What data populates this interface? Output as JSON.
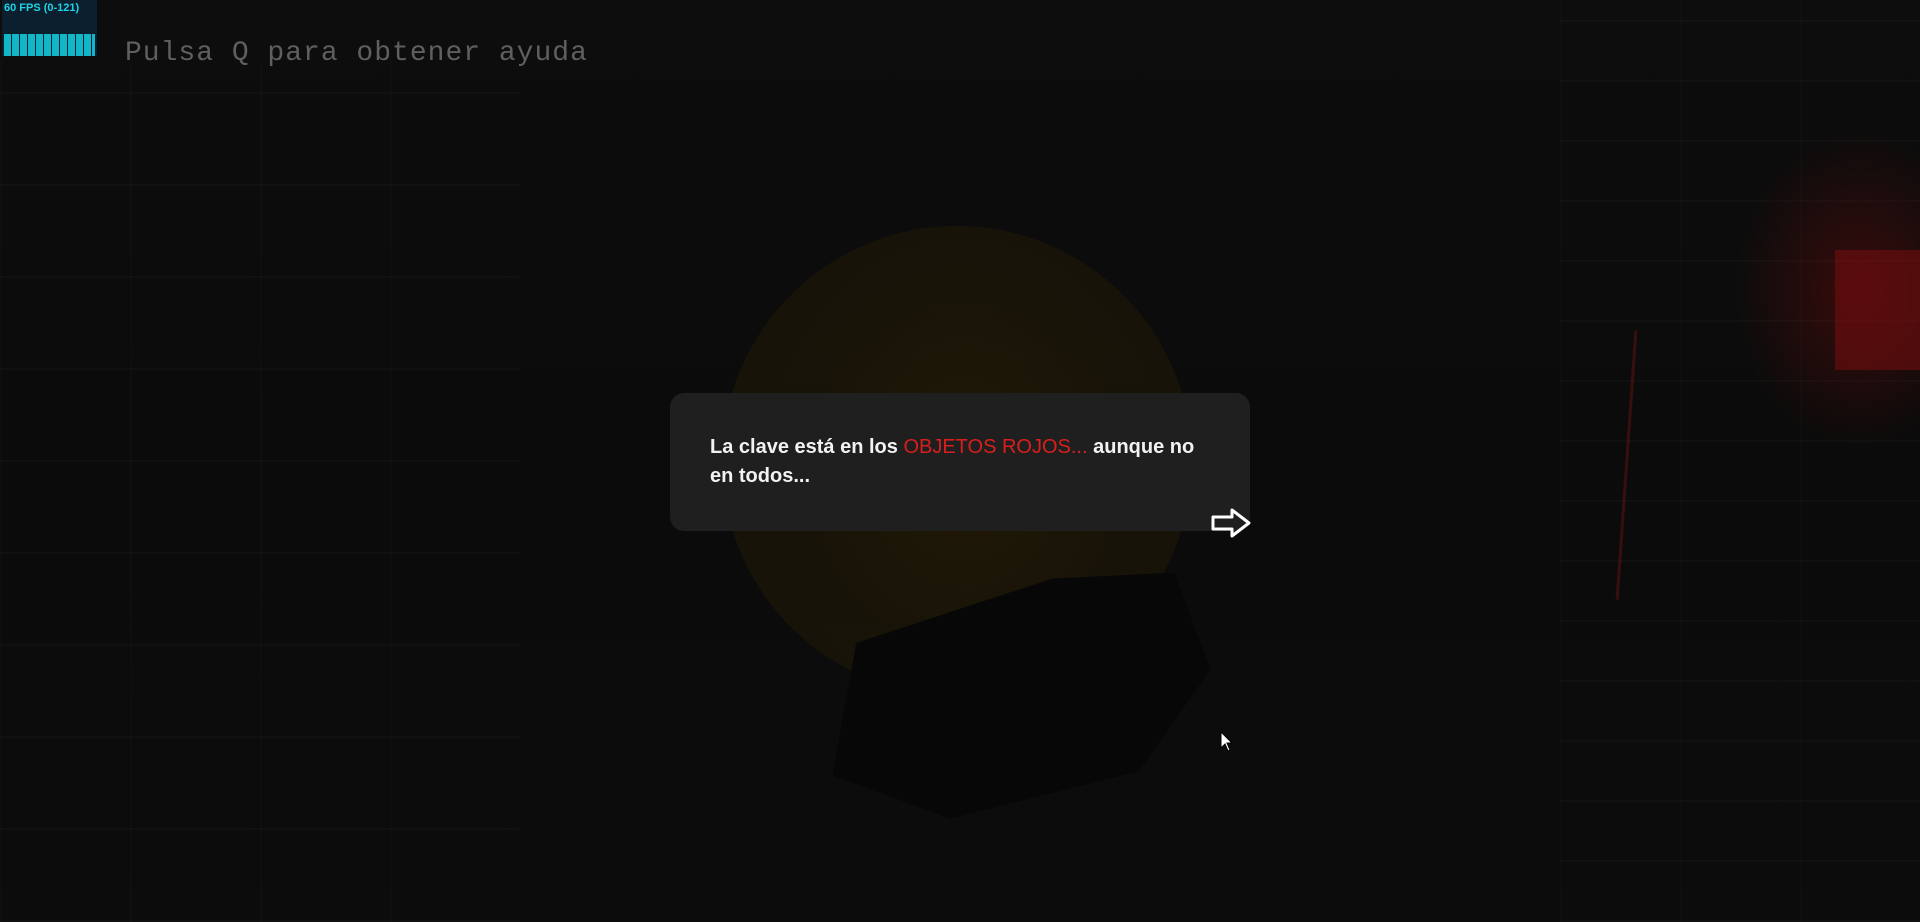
{
  "hud": {
    "fps_label": "60 FPS (0-121)",
    "help_text": "Pulsa Q para obtener ayuda"
  },
  "dialog": {
    "text_before": "La clave está en los ",
    "highlight": "OBJETOS ROJOS...",
    "text_after": " aunque no en todos...",
    "highlight_color": "#d81e1e",
    "next_icon": "arrow-right-icon"
  }
}
